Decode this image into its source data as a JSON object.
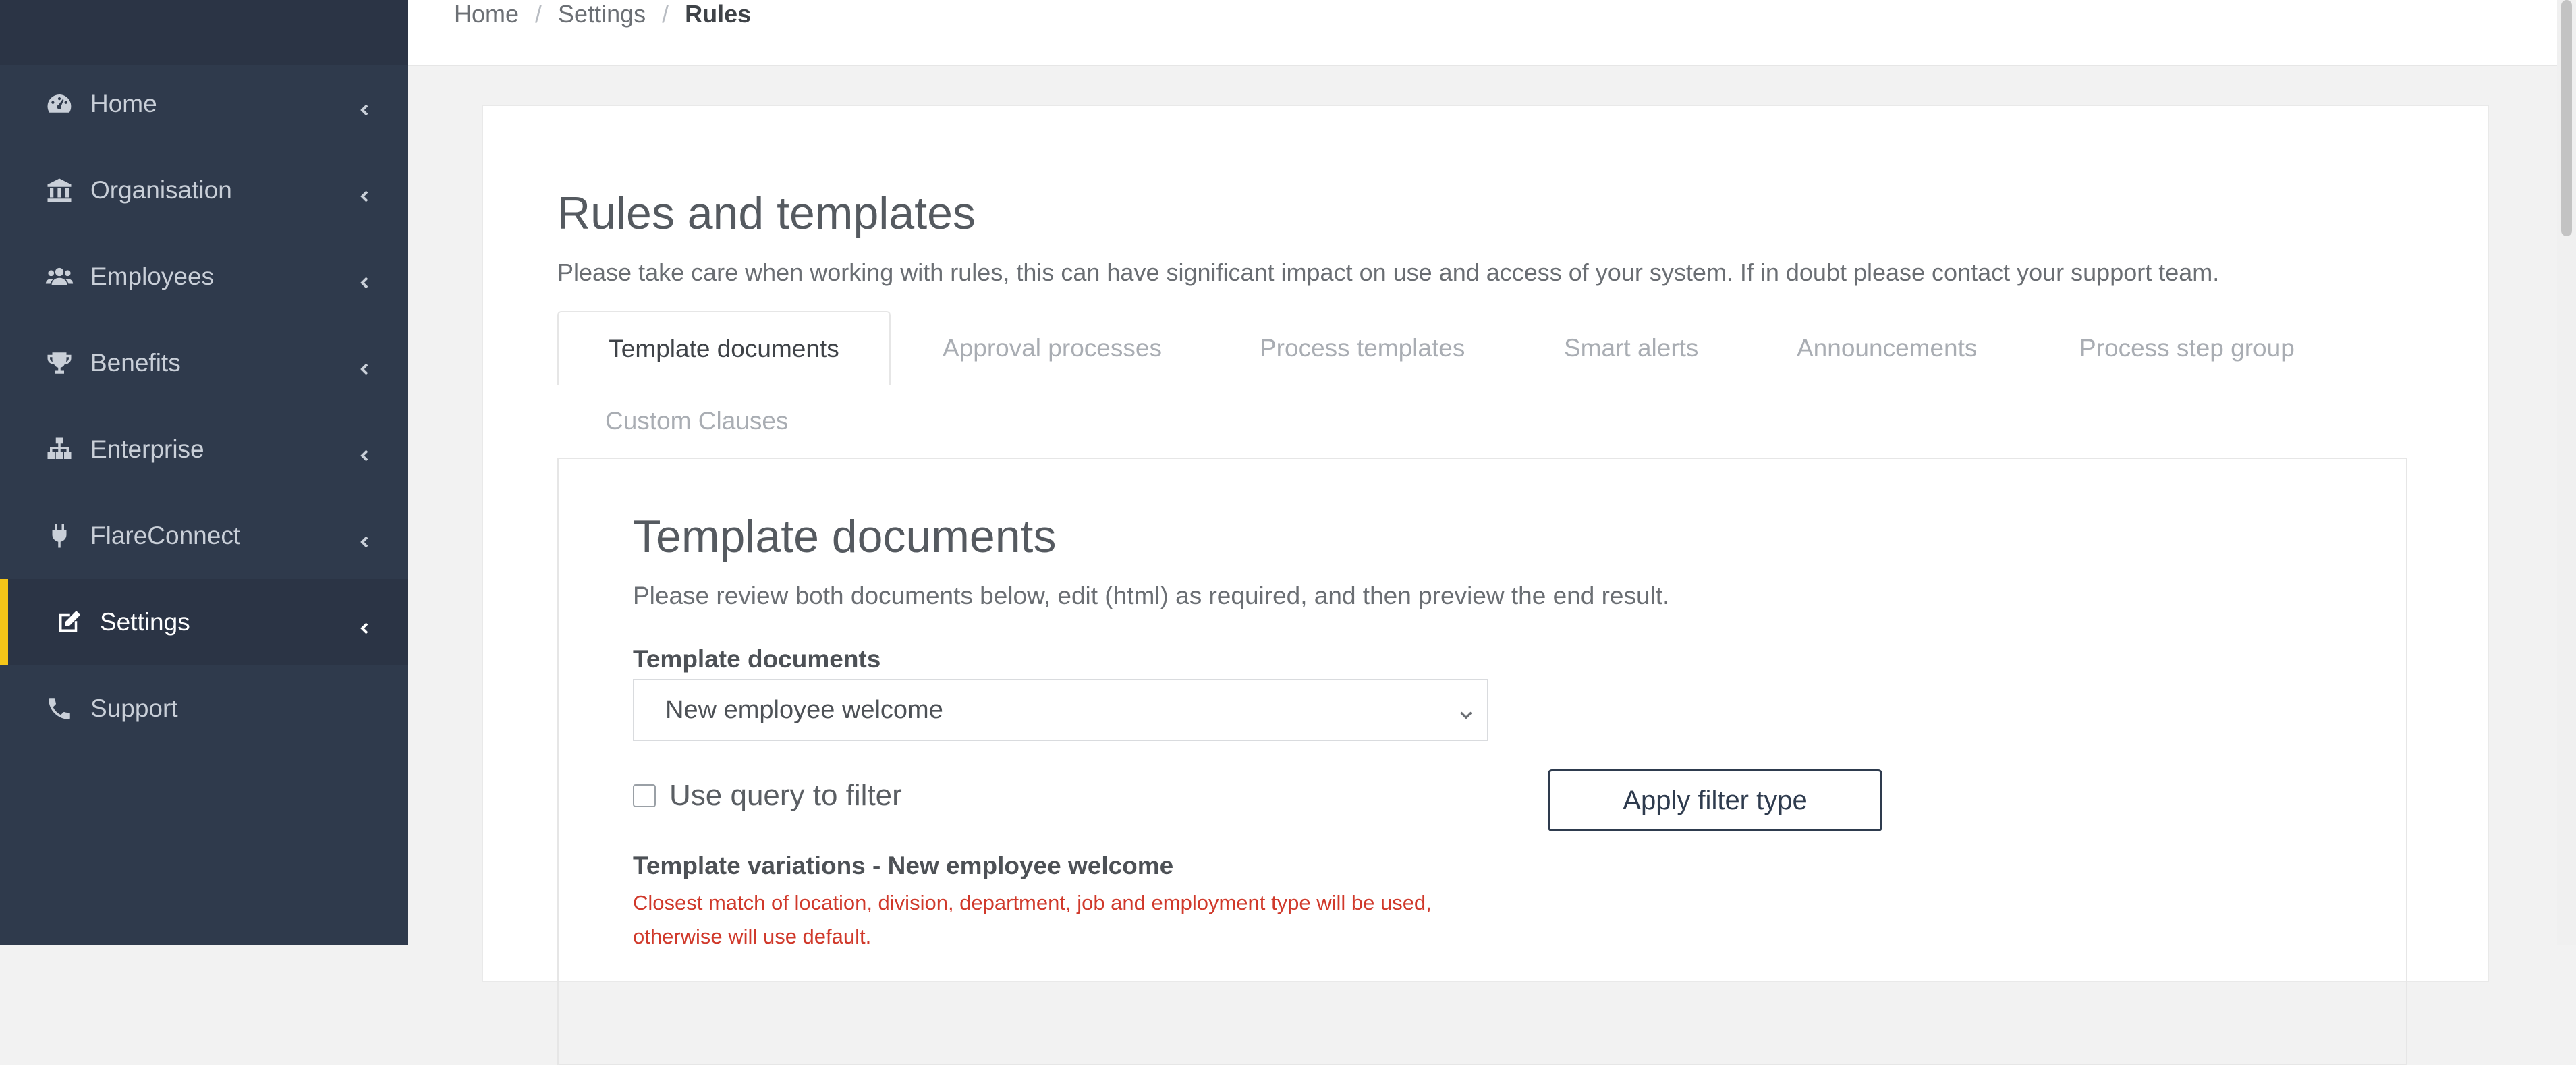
{
  "sidebar": {
    "items": [
      {
        "label": "Home",
        "icon": "dashboard-icon"
      },
      {
        "label": "Organisation",
        "icon": "bank-icon"
      },
      {
        "label": "Employees",
        "icon": "users-icon"
      },
      {
        "label": "Benefits",
        "icon": "trophy-icon"
      },
      {
        "label": "Enterprise",
        "icon": "sitemap-icon"
      },
      {
        "label": "FlareConnect",
        "icon": "plug-icon"
      },
      {
        "label": "Settings",
        "icon": "edit-icon",
        "active": true
      },
      {
        "label": "Support",
        "icon": "phone-icon"
      }
    ],
    "accent_color": "#f5c518"
  },
  "breadcrumb": {
    "home": "Home",
    "settings": "Settings",
    "current": "Rules",
    "separator": "/"
  },
  "page": {
    "title": "Rules and templates",
    "description": "Please take care when working with rules, this can have significant impact on use and access of your system. If in doubt please contact your support team."
  },
  "tabs": [
    {
      "label": "Template documents",
      "active": true
    },
    {
      "label": "Approval processes"
    },
    {
      "label": "Process templates"
    },
    {
      "label": "Smart alerts"
    },
    {
      "label": "Announcements"
    },
    {
      "label": "Process step group"
    },
    {
      "label": "Custom Clauses"
    }
  ],
  "panel": {
    "title": "Template documents",
    "description": "Please review both documents below, edit (html) as required, and then preview the end result.",
    "select_label": "Template documents",
    "select_value": "New employee welcome",
    "checkbox_label": "Use query to filter",
    "checkbox_checked": false,
    "apply_button": "Apply filter type",
    "variations_label": "Template variations - New employee welcome",
    "warning_line1": "Closest match of location, division, department, job and employment type will be used,",
    "warning_line2": "otherwise will use default."
  }
}
